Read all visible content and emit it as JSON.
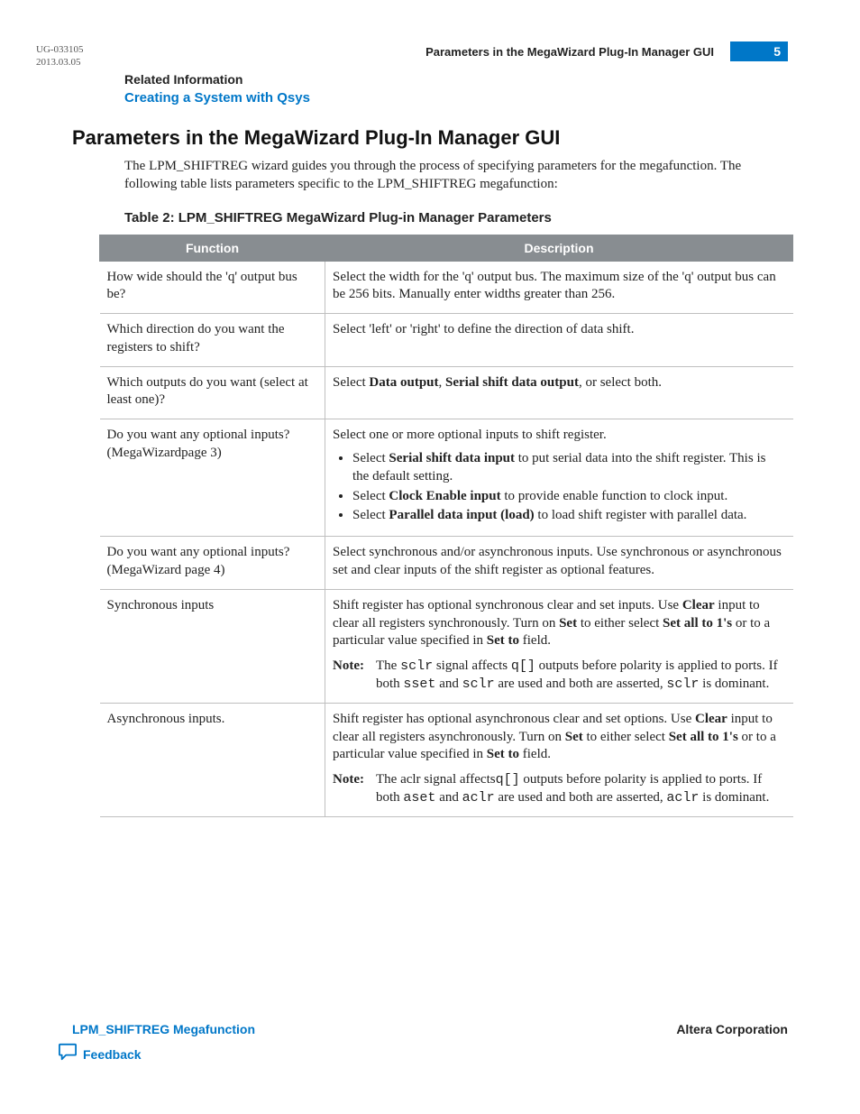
{
  "meta": {
    "doc_id": "UG-033105",
    "doc_date": "2013.03.05",
    "header_section_title": "Parameters in the MegaWizard Plug-In Manager GUI",
    "page_number": "5"
  },
  "related": {
    "heading": "Related Information",
    "link_text": "Creating a System with Qsys"
  },
  "section": {
    "heading": "Parameters in the MegaWizard Plug-In Manager GUI",
    "intro": "The LPM_SHIFTREG wizard guides you through the process of specifying parameters for the megafunction. The following table lists parameters specific to the LPM_SHIFTREG megafunction:"
  },
  "table": {
    "caption": "Table 2: LPM_SHIFTREG MegaWizard Plug-in Manager Parameters",
    "col_function": "Function",
    "col_description": "Description",
    "rows": {
      "r1": {
        "func": "How wide should the 'q' output bus be?",
        "desc": "Select the width for the 'q' output bus. The maximum size of the 'q' output bus can be 256 bits. Manually enter widths greater than 256."
      },
      "r2": {
        "func": "Which direction do you want the registers to shift?",
        "desc": "Select 'left' or 'right' to define the direction of data shift."
      },
      "r3": {
        "func": "Which outputs do you want (select at least one)?",
        "desc_pre": "Select ",
        "bold1": "Data output",
        "mid": ", ",
        "bold2": "Serial shift data output",
        "desc_post": ", or select both."
      },
      "r4": {
        "func": "Do you want any optional inputs? (MegaWizardpage 3)",
        "lead": "Select one or more optional inputs to shift register.",
        "li1_pre": "Select ",
        "li1_b": "Serial shift data input",
        "li1_post": " to put serial data into the shift register. This is the default setting.",
        "li2_pre": "Select ",
        "li2_b": "Clock Enable input",
        "li2_post": " to provide enable function to clock input.",
        "li3_pre": "Select ",
        "li3_b": "Parallel data input (load)",
        "li3_post": " to load shift register with parallel data."
      },
      "r5": {
        "func": "Do you want any optional inputs? (MegaWizard page 4)",
        "desc": "Select synchronous and/or asynchronous inputs. Use synchronous or asynchronous set and clear inputs of the shift register as optional features."
      },
      "r6": {
        "func": "Synchronous inputs",
        "p1_a": "Shift register has optional synchronous clear and set inputs. Use ",
        "p1_b1": "Clear",
        "p1_b": " input to clear all registers synchronously. Turn on ",
        "p1_b2": "Set",
        "p1_c": " to either select ",
        "p1_b3": "Set all to 1's",
        "p1_d": " or to a particular value specified in ",
        "p1_b4": "Set to",
        "p1_e": " field.",
        "note_label": "Note:",
        "note_a": "The ",
        "note_c1": "sclr",
        "note_b": " signal affects ",
        "note_c2": "q[]",
        "note_c": " outputs before polarity is applied to ports. If both ",
        "note_c3": "sset",
        "note_d": " and ",
        "note_c4": "sclr",
        "note_e": " are used and both are asserted, ",
        "note_c5": "sclr",
        "note_f": " is dominant."
      },
      "r7": {
        "func": "Asynchronous inputs.",
        "p1_a": "Shift register has optional asynchronous clear and set options. Use ",
        "p1_b1": "Clear",
        "p1_b": " input to clear all registers asynchronously. Turn on ",
        "p1_b2": "Set",
        "p1_c": " to either select ",
        "p1_b3": "Set all to 1's",
        "p1_d": " or to a particular value specified in ",
        "p1_b4": "Set to",
        "p1_e": " field.",
        "note_label": "Note:",
        "note_a": "The aclr signal affects",
        "note_c2": "q[]",
        "note_c": " outputs before polarity is applied to ports. If both ",
        "note_c3": "aset",
        "note_d": " and ",
        "note_c4": "aclr",
        "note_e": " are used and both are asserted, ",
        "note_c5": "aclr",
        "note_f": " is dominant."
      }
    }
  },
  "footer": {
    "left_link": "LPM_SHIFTREG Megafunction",
    "right_text": "Altera Corporation",
    "feedback": "Feedback"
  },
  "icons": {
    "feedback": "feedback-icon"
  },
  "colors": {
    "accent": "#0077c8",
    "table_header_bg": "#888d91"
  }
}
